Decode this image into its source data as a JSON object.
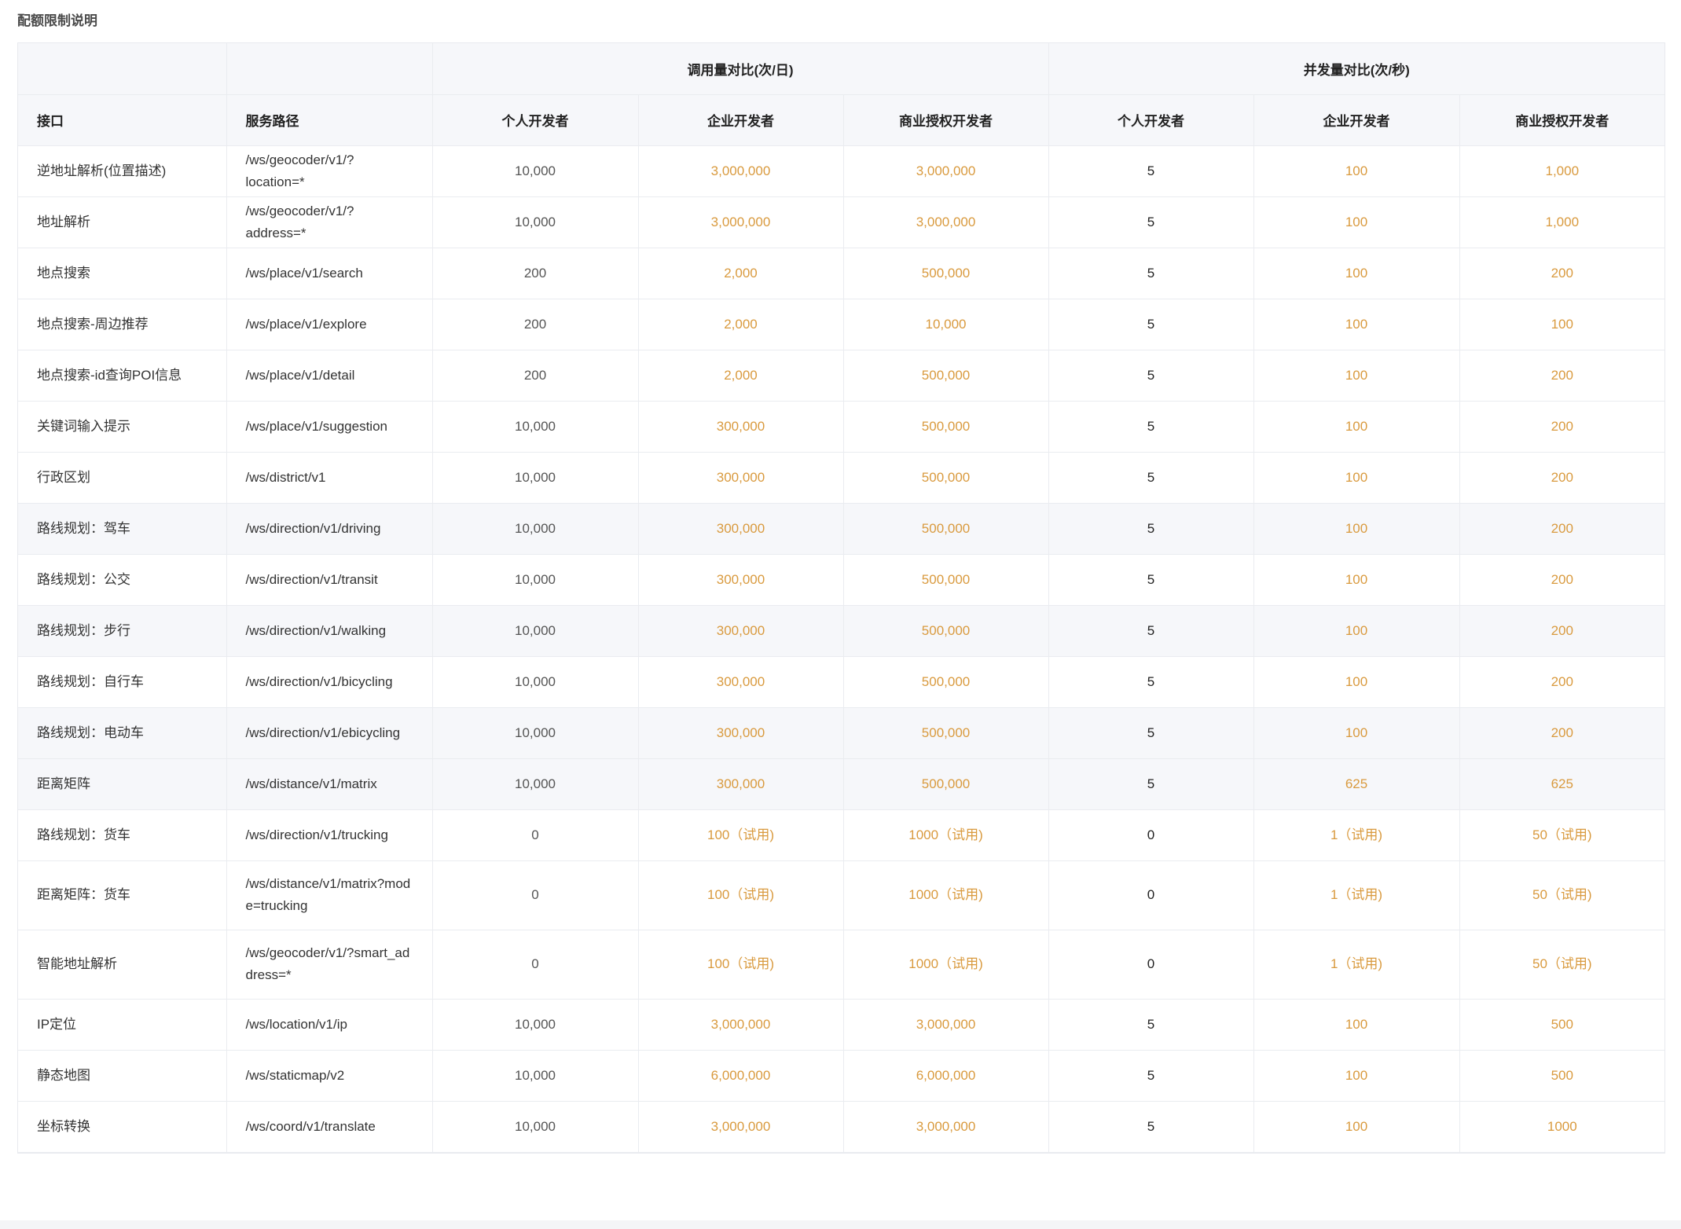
{
  "section_title": "配额限制说明",
  "header": {
    "group_calls": "调用量对比(次/日)",
    "group_concurrency": "并发量对比(次/秒)",
    "col_api": "接口",
    "col_path": "服务路径",
    "col_personal": "个人开发者",
    "col_enterprise": "企业开发者",
    "col_commercial": "商业授权开发者",
    "col_personal_2": "个人开发者",
    "col_enterprise_2": "企业开发者",
    "col_commercial_2": "商业授权开发者"
  },
  "rows": [
    {
      "api": "逆地址解析(位置描述)",
      "path": "/ws/geocoder/v1/?location=*",
      "c1": "10,000",
      "c2": "3,000,000",
      "c3": "3,000,000",
      "q1": "5",
      "q2": "100",
      "q3": "1,000"
    },
    {
      "api": "地址解析",
      "path": "/ws/geocoder/v1/?address=*",
      "c1": "10,000",
      "c2": "3,000,000",
      "c3": "3,000,000",
      "q1": "5",
      "q2": "100",
      "q3": "1,000"
    },
    {
      "api": "地点搜索",
      "path": "/ws/place/v1/search",
      "c1": "200",
      "c2": "2,000",
      "c3": "500,000",
      "q1": "5",
      "q2": "100",
      "q3": "200"
    },
    {
      "api": "地点搜索-周边推荐",
      "path": "/ws/place/v1/explore",
      "c1": "200",
      "c2": "2,000",
      "c3": "10,000",
      "q1": "5",
      "q2": "100",
      "q3": "100"
    },
    {
      "api": "地点搜索-id查询POI信息",
      "path": "/ws/place/v1/detail",
      "c1": "200",
      "c2": "2,000",
      "c3": "500,000",
      "q1": "5",
      "q2": "100",
      "q3": "200"
    },
    {
      "api": "关键词输入提示",
      "path": "/ws/place/v1/suggestion",
      "c1": "10,000",
      "c2": "300,000",
      "c3": "500,000",
      "q1": "5",
      "q2": "100",
      "q3": "200"
    },
    {
      "api": "行政区划",
      "path": "/ws/district/v1",
      "c1": "10,000",
      "c2": "300,000",
      "c3": "500,000",
      "q1": "5",
      "q2": "100",
      "q3": "200"
    },
    {
      "api": "路线规划：驾车",
      "path": "/ws/direction/v1/driving",
      "c1": "10,000",
      "c2": "300,000",
      "c3": "500,000",
      "q1": "5",
      "q2": "100",
      "q3": "200"
    },
    {
      "api": "路线规划：公交",
      "path": "/ws/direction/v1/transit",
      "c1": "10,000",
      "c2": "300,000",
      "c3": "500,000",
      "q1": "5",
      "q2": "100",
      "q3": "200"
    },
    {
      "api": "路线规划：步行",
      "path": "/ws/direction/v1/walking",
      "c1": "10,000",
      "c2": "300,000",
      "c3": "500,000",
      "q1": "5",
      "q2": "100",
      "q3": "200"
    },
    {
      "api": "路线规划：自行车",
      "path": "/ws/direction/v1/bicycling",
      "c1": "10,000",
      "c2": "300,000",
      "c3": "500,000",
      "q1": "5",
      "q2": "100",
      "q3": "200"
    },
    {
      "api": "路线规划：电动车",
      "path": "/ws/direction/v1/ebicycling",
      "c1": "10,000",
      "c2": "300,000",
      "c3": "500,000",
      "q1": "5",
      "q2": "100",
      "q3": "200"
    },
    {
      "api": "距离矩阵",
      "path": "/ws/distance/v1/matrix",
      "c1": "10,000",
      "c2": "300,000",
      "c3": "500,000",
      "q1": "5",
      "q2": "625",
      "q3": "625"
    },
    {
      "api": "路线规划：货车",
      "path": "/ws/direction/v1/trucking",
      "c1": "0",
      "c2": "100（试用)",
      "c3": "1000（试用)",
      "q1": "0",
      "q2": "1（试用)",
      "q3": "50（试用)"
    },
    {
      "api": "距离矩阵：货车",
      "path": "/ws/distance/v1/matrix?mode=trucking",
      "c1": "0",
      "c2": "100（试用)",
      "c3": "1000（试用)",
      "q1": "0",
      "q2": "1（试用)",
      "q3": "50（试用)"
    },
    {
      "api": "智能地址解析",
      "path": "/ws/geocoder/v1/?smart_address=*",
      "c1": "0",
      "c2": "100（试用)",
      "c3": "1000（试用)",
      "q1": "0",
      "q2": "1（试用)",
      "q3": "50（试用)"
    },
    {
      "api": "IP定位",
      "path": "/ws/location/v1/ip",
      "c1": "10,000",
      "c2": "3,000,000",
      "c3": "3,000,000",
      "q1": "5",
      "q2": "100",
      "q3": "500"
    },
    {
      "api": "静态地图",
      "path": "/ws/staticmap/v2",
      "c1": "10,000",
      "c2": "6,000,000",
      "c3": "6,000,000",
      "q1": "5",
      "q2": "100",
      "q3": "500"
    },
    {
      "api": "坐标转换",
      "path": "/ws/coord/v1/translate",
      "c1": "10,000",
      "c2": "3,000,000",
      "c3": "3,000,000",
      "q1": "5",
      "q2": "100",
      "q3": "1000"
    }
  ]
}
